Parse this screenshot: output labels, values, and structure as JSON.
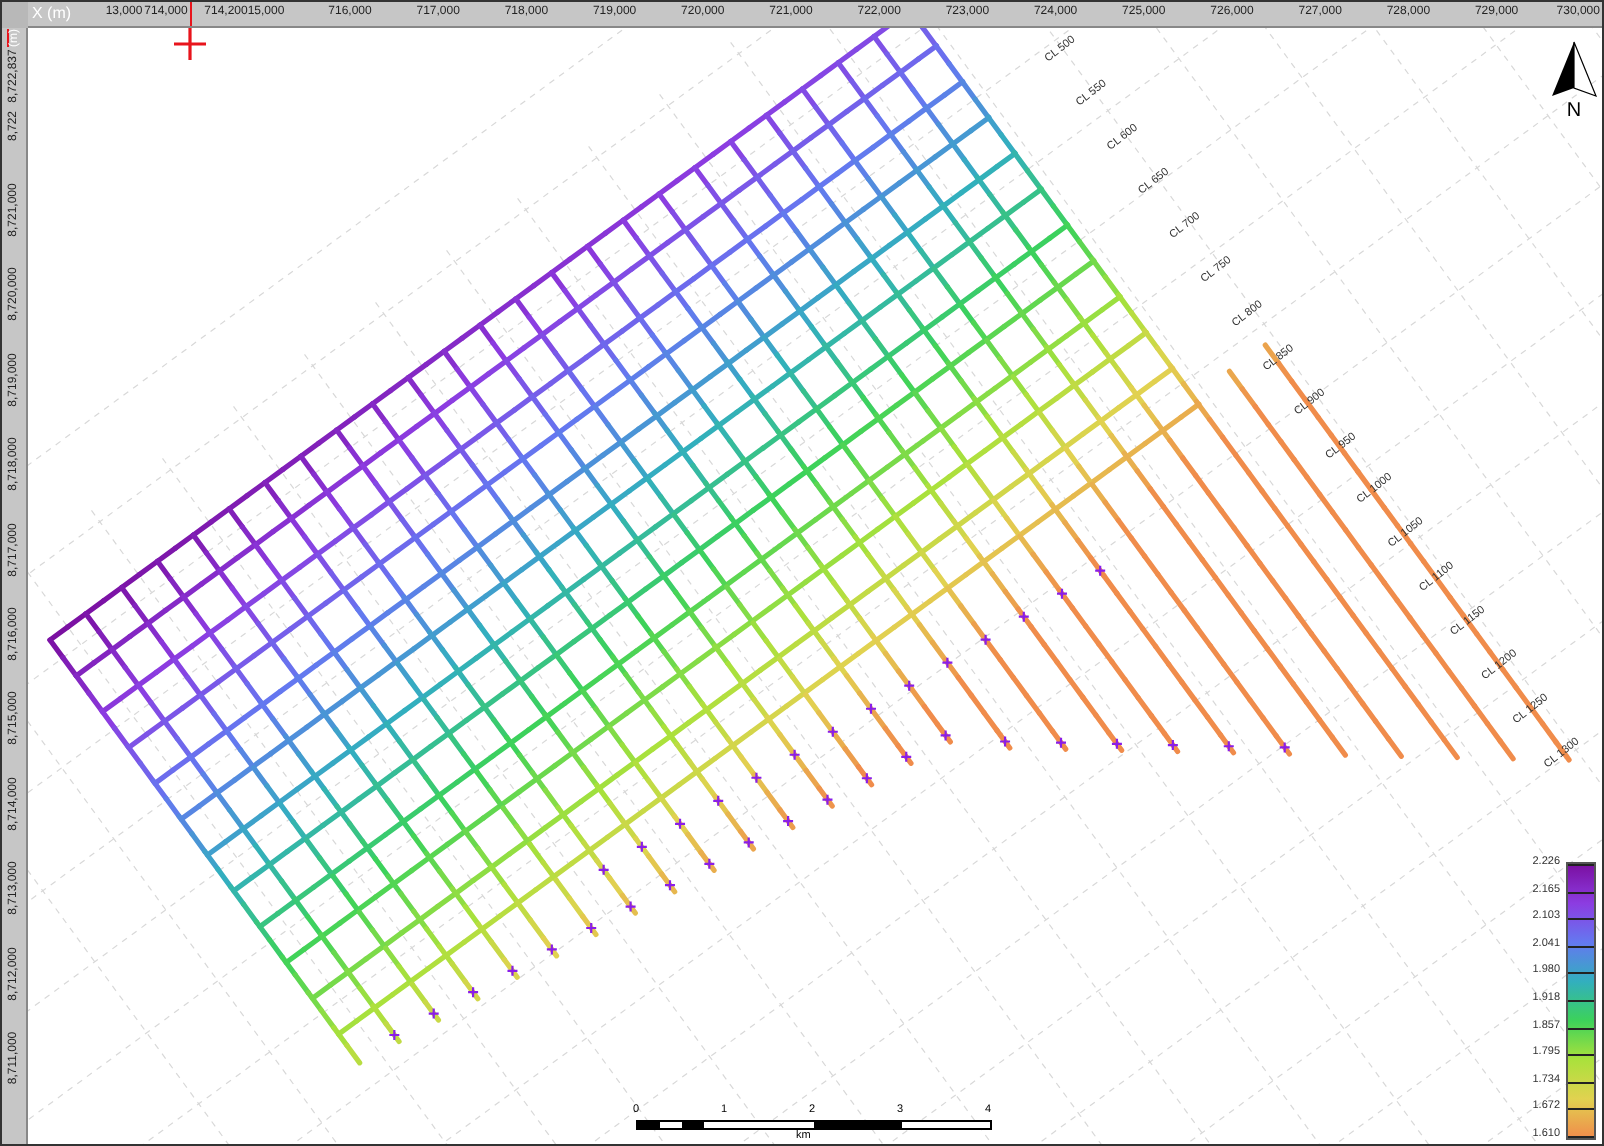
{
  "rulers": {
    "x_title": "X (m)",
    "x_ticks": [
      "13,000",
      "714,000",
      "714,200",
      "15,000",
      "716,000",
      "717,000",
      "718,000",
      "719,000",
      "720,000",
      "721,000",
      "722,000",
      "723,000",
      "724,000",
      "725,000",
      "726,000",
      "727,000",
      "728,000",
      "729,000",
      "730,000"
    ],
    "y_title": "(m)",
    "y_ticks": [
      "8,722,837",
      "8,722",
      "8,721,000",
      "8,720,000",
      "8,719,000",
      "8,718,000",
      "8,717,000",
      "8,716,000",
      "8,715,000",
      "8,714,000",
      "8,713,000",
      "8,712,000",
      "8,711,000"
    ]
  },
  "survey_lines": {
    "labels": [
      "CL 500",
      "CL 550",
      "CL 600",
      "CL 650",
      "CL 700",
      "CL 750",
      "CL 800",
      "CL 850",
      "CL 900",
      "CL 950",
      "CL 1000",
      "CL 1050",
      "CL 1100",
      "CL 1150",
      "CL 1200",
      "CL 1250",
      "CL 1300"
    ]
  },
  "north_arrow": {
    "label": "N"
  },
  "legend": {
    "labels": [
      "2.226",
      "2.165",
      "2.103",
      "2.041",
      "1.980",
      "1.918",
      "1.857",
      "1.795",
      "1.734",
      "1.672",
      "1.610"
    ]
  },
  "scale_bar": {
    "ticks": [
      "0",
      "1",
      "2",
      "3",
      "4"
    ],
    "unit": "km"
  }
}
